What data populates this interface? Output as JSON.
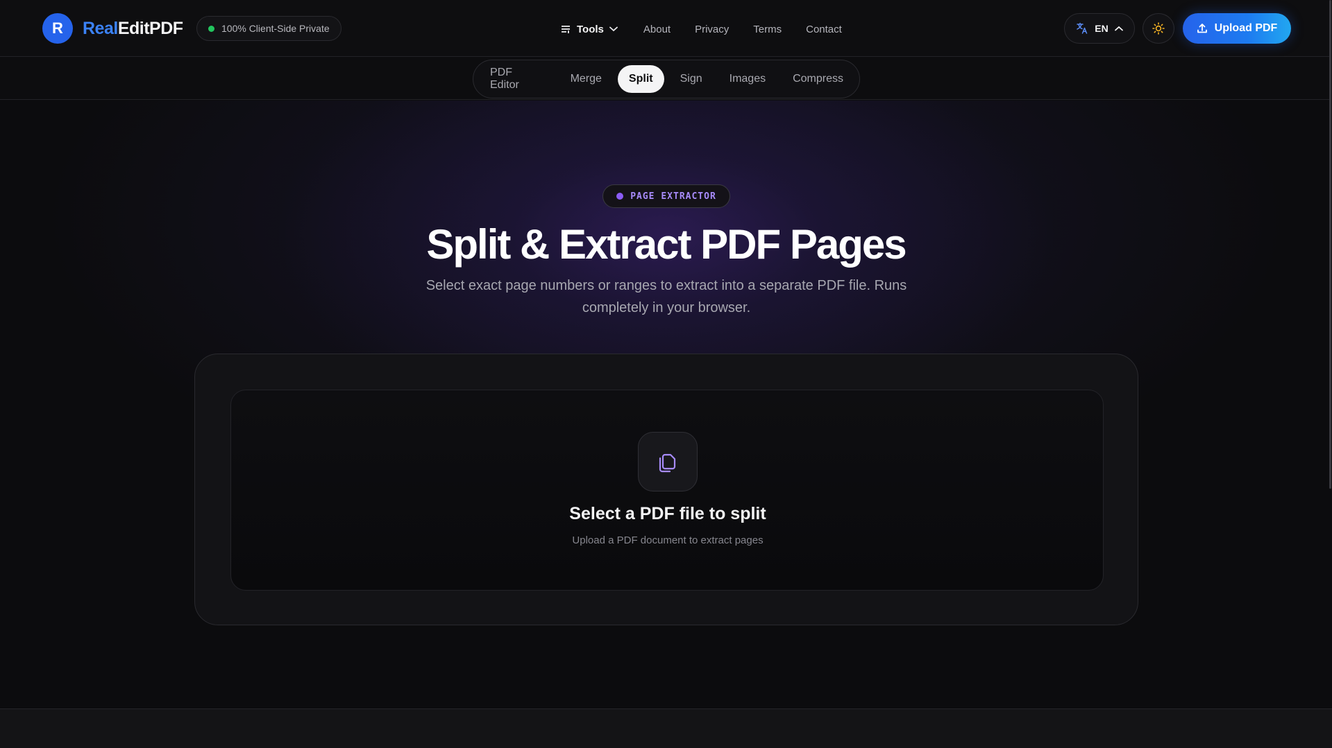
{
  "brand": {
    "logo_letter": "R",
    "name_part1": "Real",
    "name_part2": "EditPDF",
    "accent_color": "#2563eb"
  },
  "header": {
    "privacy_badge": "100% Client-Side Private",
    "nav": {
      "tools_label": "Tools",
      "about_label": "About",
      "privacy_label": "Privacy",
      "terms_label": "Terms",
      "contact_label": "Contact"
    },
    "language": "EN",
    "upload_label": "Upload PDF"
  },
  "tool_tabs": [
    {
      "label": "PDF Editor",
      "active": false
    },
    {
      "label": "Merge",
      "active": false
    },
    {
      "label": "Split",
      "active": true
    },
    {
      "label": "Sign",
      "active": false
    },
    {
      "label": "Images",
      "active": false
    },
    {
      "label": "Compress",
      "active": false
    }
  ],
  "hero": {
    "badge": "PAGE EXTRACTOR",
    "title": "Split & Extract PDF Pages",
    "subtitle": "Select exact page numbers or ranges to extract into a separate PDF file. Runs completely in your browser."
  },
  "dropzone": {
    "icon": "copy-pages-icon",
    "title": "Select a PDF file to split",
    "subtitle": "Upload a PDF document to extract pages"
  }
}
